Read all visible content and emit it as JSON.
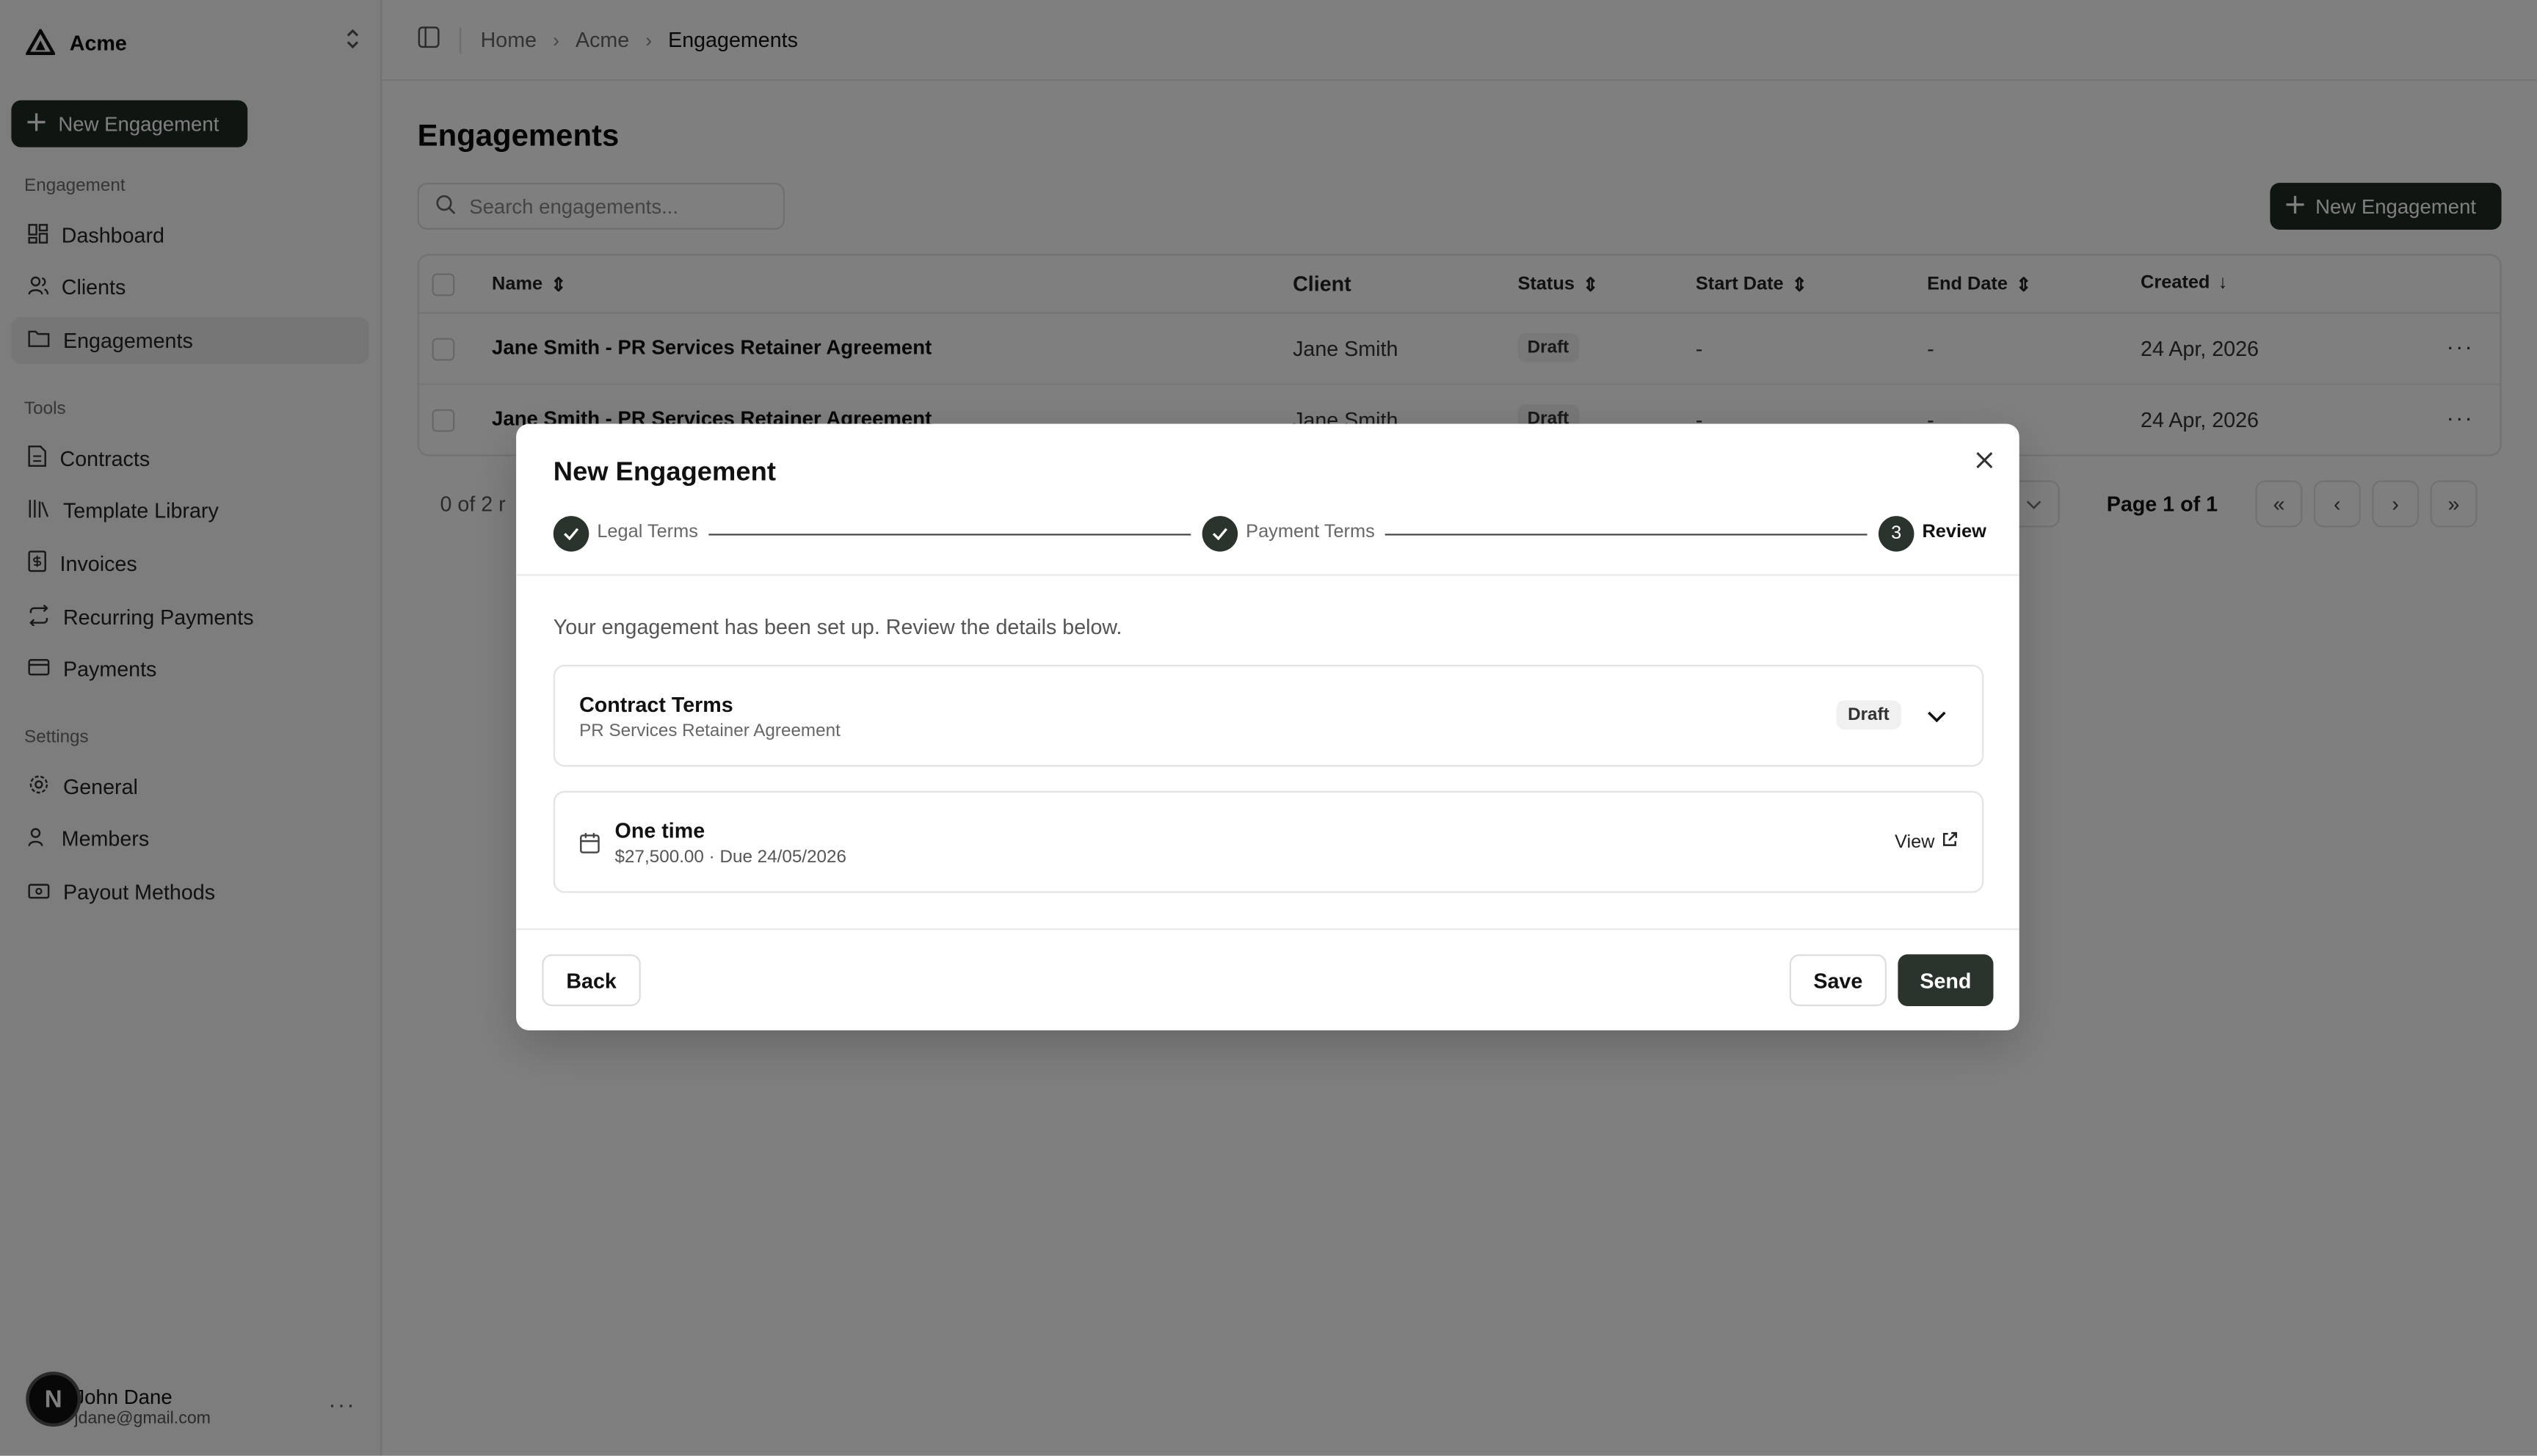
{
  "sidebar": {
    "brand": "Acme",
    "new_button": "New Engagement",
    "sections": [
      {
        "label": "Engagement",
        "items": [
          {
            "label": "Dashboard",
            "icon": "dashboard-icon"
          },
          {
            "label": "Clients",
            "icon": "users-icon"
          },
          {
            "label": "Engagements",
            "icon": "folder-icon",
            "active": true
          }
        ]
      },
      {
        "label": "Tools",
        "items": [
          {
            "label": "Contracts",
            "icon": "file-icon"
          },
          {
            "label": "Template Library",
            "icon": "library-icon"
          },
          {
            "label": "Invoices",
            "icon": "receipt-icon"
          },
          {
            "label": "Recurring Payments",
            "icon": "repeat-icon"
          },
          {
            "label": "Payments",
            "icon": "credit-card-icon"
          }
        ]
      },
      {
        "label": "Settings",
        "items": [
          {
            "label": "General",
            "icon": "gear-icon"
          },
          {
            "label": "Members",
            "icon": "users-icon"
          },
          {
            "label": "Payout Methods",
            "icon": "banknote-icon"
          }
        ]
      }
    ],
    "user": {
      "initial": "N",
      "name": "John Dane",
      "email": "jdane@gmail.com"
    }
  },
  "breadcrumb": [
    "Home",
    "Acme",
    "Engagements"
  ],
  "page": {
    "title": "Engagements",
    "search_placeholder": "Search engagements...",
    "new_button": "New Engagement"
  },
  "table": {
    "columns": [
      "Name",
      "Client",
      "Status",
      "Start Date",
      "End Date",
      "Created"
    ],
    "rows": [
      {
        "name": "Jane Smith - PR Services Retainer Agreement",
        "client": "Jane Smith",
        "status": "Draft",
        "start": "-",
        "end": "-",
        "created": "24 Apr, 2026"
      },
      {
        "name": "Jane Smith - PR Services Retainer Agreement",
        "client": "Jane Smith",
        "status": "Draft",
        "start": "-",
        "end": "-",
        "created": "24 Apr, 2026"
      }
    ],
    "footer_left": "0 of 2 r",
    "page_info": "Page 1 of 1"
  },
  "modal": {
    "title": "New Engagement",
    "steps": [
      {
        "label": "Legal Terms",
        "state": "done"
      },
      {
        "label": "Payment Terms",
        "state": "done"
      },
      {
        "label": "Review",
        "number": "3",
        "state": "current"
      }
    ],
    "intro": "Your engagement has been set up. Review the details below.",
    "contract_card": {
      "title": "Contract Terms",
      "subtitle": "PR Services Retainer Agreement",
      "badge": "Draft"
    },
    "payment_card": {
      "title": "One time",
      "subtitle": "$27,500.00 · Due 24/05/2026",
      "link": "View"
    },
    "buttons": {
      "back": "Back",
      "save": "Save",
      "send": "Send"
    }
  },
  "colors": {
    "primary": "#1f2a22",
    "overlay": "rgba(0,0,0,0.5)"
  }
}
